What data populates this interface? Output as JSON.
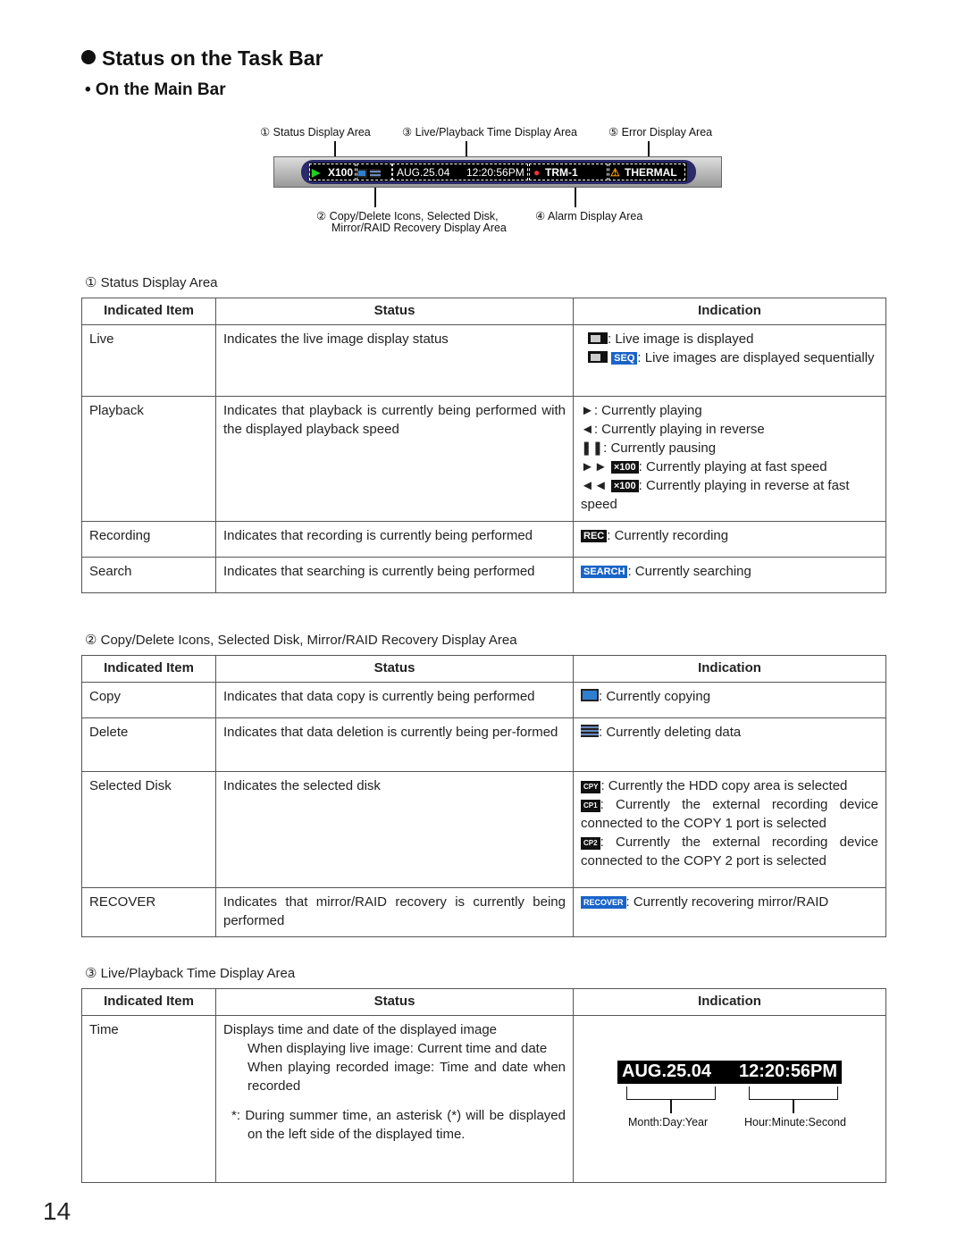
{
  "title": "Status on the Task Bar",
  "subtitle": "• On the Main Bar",
  "diagram": {
    "labels": [
      "① Status Display Area",
      "③ Live/Playback Time Display Area",
      "⑤ Error Display Area",
      "② Copy/Delete Icons, Selected Disk,",
      "Mirror/RAID Recovery Display Area",
      "④ Alarm Display Area"
    ],
    "bar": {
      "speed": "X100",
      "date": "AUG.25.04",
      "time": "12:20:56PM",
      "alarm": "TRM-1",
      "error": "THERMAL"
    }
  },
  "headers": [
    "Indicated Item",
    "Status",
    "Indication"
  ],
  "sections": [
    "① Status Display Area",
    "② Copy/Delete Icons, Selected Disk, Mirror/RAID Recovery Display Area",
    "③ Live/Playback Time Display Area"
  ],
  "t1": {
    "live": {
      "item": "Live",
      "status": "Indicates the live image display status",
      "i1": ": Live image is displayed",
      "seq": "SEQ",
      "i2": ": Live images are displayed sequentially"
    },
    "play": {
      "item": "Playback",
      "status": "Indicates that playback is currently being performed with the displayed playback speed",
      "i1": "►: Currently playing",
      "i2": "◄: Currently playing in reverse",
      "i3": "❚❚: Currently pausing",
      "ff": "►►",
      "x": "×100",
      "i4": ": Currently playing at fast speed",
      "rw": "◄◄",
      "i5": ": Currently playing in reverse at fast speed"
    },
    "rec": {
      "item": "Recording",
      "status": "Indicates that recording is currently being performed",
      "badge": "REC",
      "i": ": Currently recording"
    },
    "search": {
      "item": "Search",
      "status": "Indicates that searching is currently being performed",
      "badge": "SEARCH",
      "i": ": Currently searching"
    }
  },
  "t2": {
    "copy": {
      "item": "Copy",
      "status": "Indicates that data copy is currently being performed",
      "i": ": Currently copying"
    },
    "del": {
      "item": "Delete",
      "status": "Indicates that data deletion is currently being per-formed",
      "i": ": Currently deleting data"
    },
    "disk": {
      "item": "Selected Disk",
      "status": "Indicates the selected disk",
      "b1": "CPY",
      "i1": ": Currently the HDD copy area is selected",
      "b2": "CP1",
      "i2": ": Currently the external recording device connected to the COPY 1 port is selected",
      "b3": "CP2",
      "i3": ": Currently the external recording device connected to the COPY 2 port is selected"
    },
    "recover": {
      "item": "RECOVER",
      "status": "Indicates that mirror/RAID recovery is currently being performed",
      "badge": "RECOVER",
      "i": ": Currently recovering mirror/RAID"
    }
  },
  "t3": {
    "item": "Time",
    "s1": "Displays time and date of the displayed image",
    "s2": "When displaying live image: Current time and date",
    "s3": "When playing recorded image: Time and date when recorded",
    "s4": "*: During summer time, an asterisk (*) will be displayed on the left side of the displayed time.",
    "date": "AUG.25.04",
    "time": "12:20:56PM",
    "dlabel": "Month:Day:Year",
    "tlabel": "Hour:Minute:Second"
  },
  "page_number": "14"
}
